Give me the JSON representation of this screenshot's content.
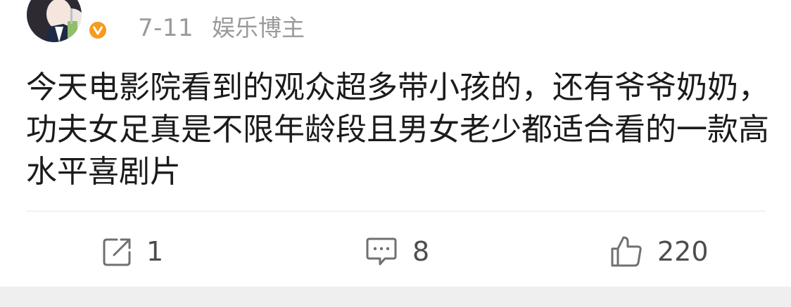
{
  "post": {
    "time": "7-11",
    "author_role": "娱乐博主",
    "text": "今天电影院看到的观众超多带小孩的，还有爷爷奶奶，功夫女足真是不限年龄段且男女老少都适合看的一款高水平喜剧片"
  },
  "actions": {
    "repost": {
      "icon": "share-icon",
      "count": "1"
    },
    "comment": {
      "icon": "comment-icon",
      "count": "8"
    },
    "like": {
      "icon": "thumbs-up-icon",
      "count": "220"
    }
  },
  "colors": {
    "meta_text": "#9a9a9a",
    "body_text": "#1b1b1b",
    "verified_badge": "#f59b1f",
    "divider": "#e6e6e6",
    "bottom_strip": "#efefef"
  }
}
